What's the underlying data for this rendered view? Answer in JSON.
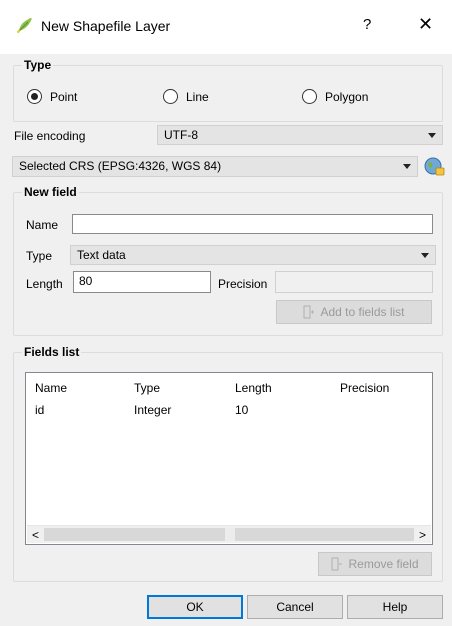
{
  "window": {
    "title": "New Shapefile Layer",
    "help_glyph": "?",
    "close_glyph": "✕"
  },
  "type_group": {
    "title": "Type",
    "options": [
      {
        "label": "Point",
        "selected": true
      },
      {
        "label": "Line",
        "selected": false
      },
      {
        "label": "Polygon",
        "selected": false
      }
    ]
  },
  "file_encoding": {
    "label": "File encoding",
    "value": "UTF-8"
  },
  "crs": {
    "value": "Selected CRS (EPSG:4326, WGS 84)"
  },
  "new_field": {
    "title": "New field",
    "name_label": "Name",
    "name_value": "",
    "type_label": "Type",
    "type_value": "Text data",
    "length_label": "Length",
    "length_value": "80",
    "precision_label": "Precision",
    "precision_value": "",
    "add_button": "Add to fields list"
  },
  "fields_list": {
    "title": "Fields list",
    "columns": [
      "Name",
      "Type",
      "Length",
      "Precision"
    ],
    "rows": [
      [
        "id",
        "Integer",
        "10",
        ""
      ]
    ],
    "remove_button": "Remove field"
  },
  "buttons": {
    "ok": "OK",
    "cancel": "Cancel",
    "help": "Help"
  },
  "icons": {
    "title": "qgis-leaf-icon",
    "crs": "globe-crs-icon",
    "add": "field-add-icon",
    "remove": "field-remove-icon"
  },
  "colors": {
    "qgis_green": "#8bc34a",
    "qgis_yellow": "#e8c93a",
    "focus_blue": "#0078d7"
  }
}
